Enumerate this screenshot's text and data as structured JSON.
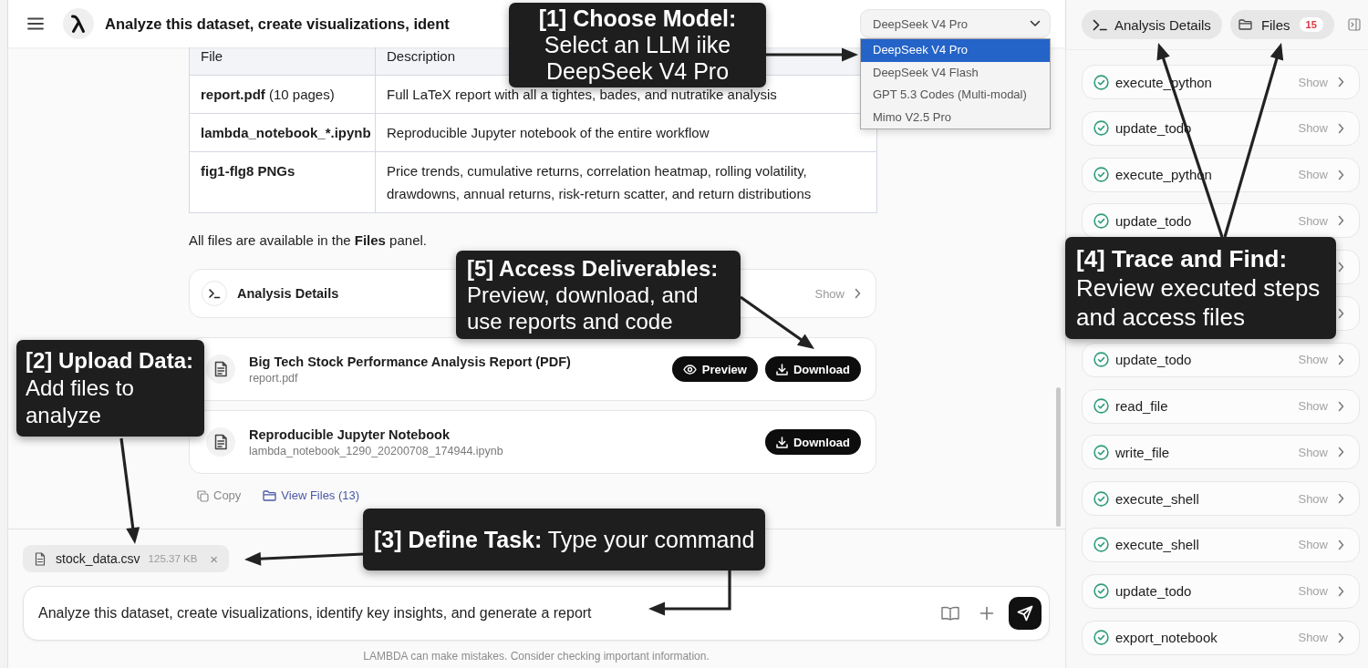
{
  "header": {
    "title": "Analyze this dataset, create visualizations, ident"
  },
  "model_select": {
    "value": "DeepSeek V4 Pro",
    "expanded": true,
    "options": [
      {
        "label": "DeepSeek V4 Pro",
        "selected": true
      },
      {
        "label": "DeepSeek V4 Flash",
        "selected": false
      },
      {
        "label": "GPT 5.3 Codes (Multi-modal)",
        "selected": false
      },
      {
        "label": "Mimo V2.5 Pro",
        "selected": false
      }
    ]
  },
  "files_table": {
    "columns": [
      "File",
      "Description"
    ],
    "rows": [
      {
        "file": "report.pdf",
        "note": "(10 pages)",
        "description": "Full LaTeX report with all a tightes, bades, and nutratike analysis"
      },
      {
        "file": "lambda_notebook_*.ipynb",
        "description": "Reproducible Jupyter notebook of the entire workflow"
      },
      {
        "file": "fig1-flg8 PNGs",
        "description": "Price trends, cumulative returns, correlation heatmap, rolling volatility, drawdowns, annual returns, risk-return scatter, and return distributions"
      }
    ]
  },
  "files_note": "All files are available in the **Files** panel.",
  "analysis_card": {
    "title": "Analysis Details",
    "action": "Show"
  },
  "deliverables": [
    {
      "title": "Big Tech Stock Performance Analysis Report (PDF)",
      "filename": "report.pdf",
      "buttons": [
        {
          "kind": "preview",
          "label": "Preview"
        },
        {
          "kind": "download",
          "label": "Download"
        }
      ]
    },
    {
      "title": "Reproducible Jupyter Notebook",
      "filename": "lambda_notebook_1290_20200708_174944.ipynb",
      "buttons": [
        {
          "kind": "download",
          "label": "Download"
        }
      ]
    }
  ],
  "message_actions": [
    {
      "kind": "copy",
      "label": "Copy"
    },
    {
      "kind": "view_files",
      "label": "View Files (13)"
    }
  ],
  "attachment": {
    "name": "stock_data.csv",
    "size": "125.37 KB",
    "remove": "×"
  },
  "composer": {
    "value": "Analyze this dataset, create visualizations, identify key insights, and generate a report"
  },
  "disclaimer": "LAMBDA can make mistakes. Consider checking important information.",
  "side_panel": {
    "buttons": [
      {
        "kind": "details",
        "label": "Analysis Details"
      },
      {
        "kind": "files",
        "label": "Files",
        "badge": "15"
      }
    ],
    "steps": [
      {
        "kind": "step",
        "name": "execute_python",
        "action": "Show"
      },
      {
        "kind": "step",
        "name": "update_todo",
        "action": "Show"
      },
      {
        "kind": "step",
        "name": "execute_python",
        "action": "Show"
      },
      {
        "kind": "step",
        "name": "update_todo",
        "action": "Show"
      },
      {
        "kind": "covered"
      },
      {
        "kind": "covered"
      },
      {
        "kind": "step",
        "name": "update_todo",
        "action": "Show"
      },
      {
        "kind": "step",
        "name": "read_file",
        "action": "Show"
      },
      {
        "kind": "step",
        "name": "write_file",
        "action": "Show"
      },
      {
        "kind": "step",
        "name": "execute_shell",
        "action": "Show"
      },
      {
        "kind": "step",
        "name": "execute_shell",
        "action": "Show"
      },
      {
        "kind": "step",
        "name": "update_todo",
        "action": "Show"
      },
      {
        "kind": "step",
        "name": "export_notebook",
        "action": "Show"
      }
    ]
  },
  "annotations": [
    {
      "kind": "stacked",
      "text": "**[1] Choose Model:** Select an LLM iike DeepSeek V4 Pro"
    },
    {
      "kind": "stacked",
      "text": "**[5] Access Deliverables:** Preview, download, and use reports and code"
    },
    {
      "kind": "stacked",
      "text": "**[4] Trace and Find:** Review executed steps and access files"
    },
    {
      "kind": "stacked",
      "text": "**[2] Upload Data:** Add files to analyze"
    },
    {
      "kind": "inline",
      "text": "**[3] Define Task:** Type your command"
    }
  ]
}
